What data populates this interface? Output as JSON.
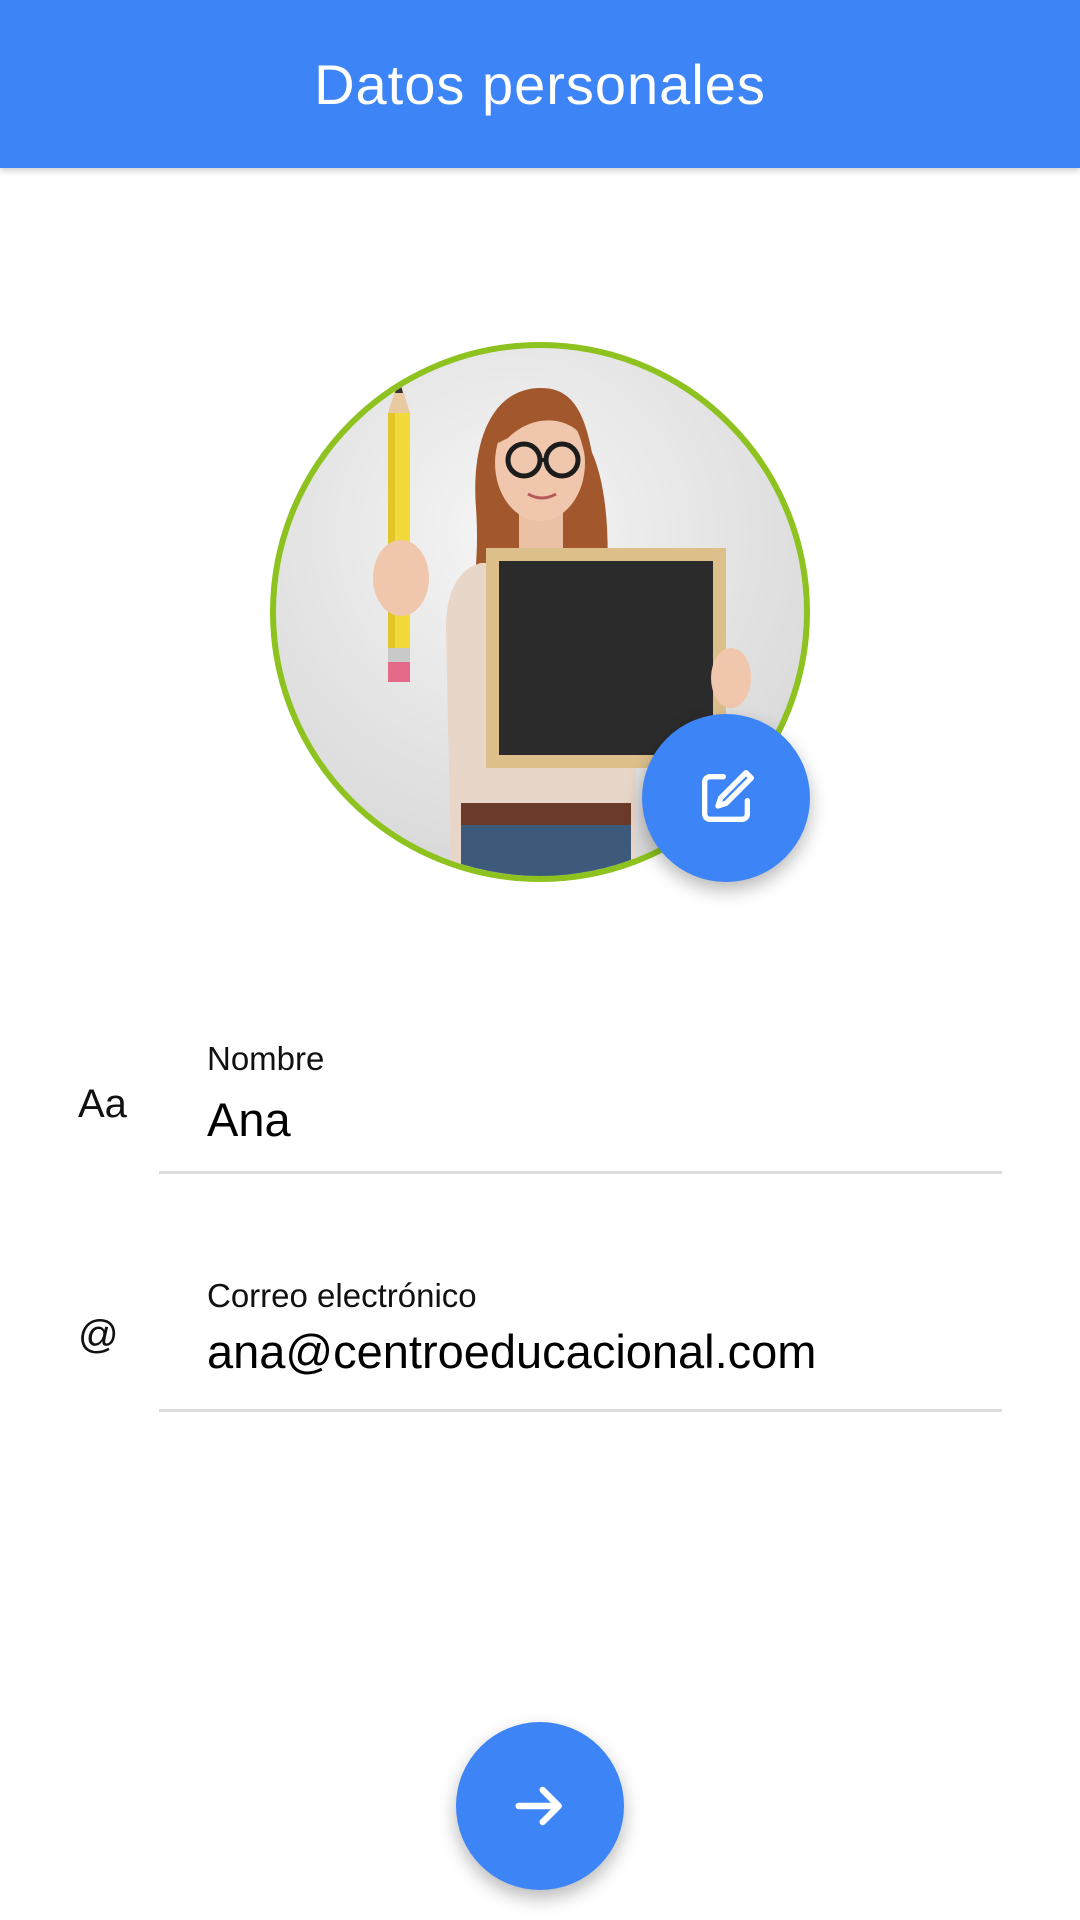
{
  "appbar": {
    "title": "Datos personales"
  },
  "profile": {
    "photo_icon": "profile-photo",
    "edit_icon": "edit-icon"
  },
  "fields": {
    "name": {
      "icon_text": "Aa",
      "label": "Nombre",
      "value": "Ana"
    },
    "email": {
      "icon_text": "@",
      "label": "Correo electrónico",
      "value": "ana@centroeducacional.com"
    }
  },
  "actions": {
    "next_icon": "arrow-right-icon"
  },
  "colors": {
    "primary": "#3D85F7",
    "avatar_ring": "#8DC21F",
    "divider": "#DCDCDC"
  }
}
